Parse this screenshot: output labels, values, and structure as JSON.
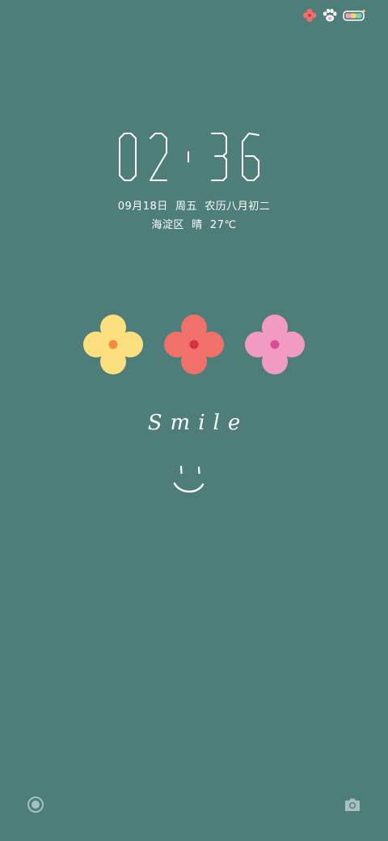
{
  "status_bar": {
    "icons": [
      "flower-icon",
      "paw-icon",
      "battery-icon"
    ],
    "battery_colors": [
      "#f3a0b5",
      "#f7d46b",
      "#7fd3b5"
    ]
  },
  "clock": {
    "hours": "02",
    "minutes": "36"
  },
  "date": {
    "date": "09月18日",
    "weekday": "周五",
    "lunar": "农历八月初二",
    "full": "09月18日  周五  农历八月初二"
  },
  "weather": {
    "location": "海淀区",
    "condition": "晴",
    "temperature": "27℃",
    "full": "海淀区  晴  27℃"
  },
  "flowers": [
    {
      "name": "yellow-flower",
      "petal_color": "#fce07f",
      "center_color": "#f5883c"
    },
    {
      "name": "red-flower",
      "petal_color": "#f2706a",
      "center_color": "#d93145"
    },
    {
      "name": "pink-flower",
      "petal_color": "#f29bc0",
      "center_color": "#d94f97"
    }
  ],
  "smile_text": "Smile",
  "bottom_bar": {
    "left_icon": "record-icon",
    "right_icon": "camera-icon"
  },
  "colors": {
    "background": "#4e7e79",
    "text": "#ffffff",
    "bottom_icons": "#a8c0bd"
  }
}
